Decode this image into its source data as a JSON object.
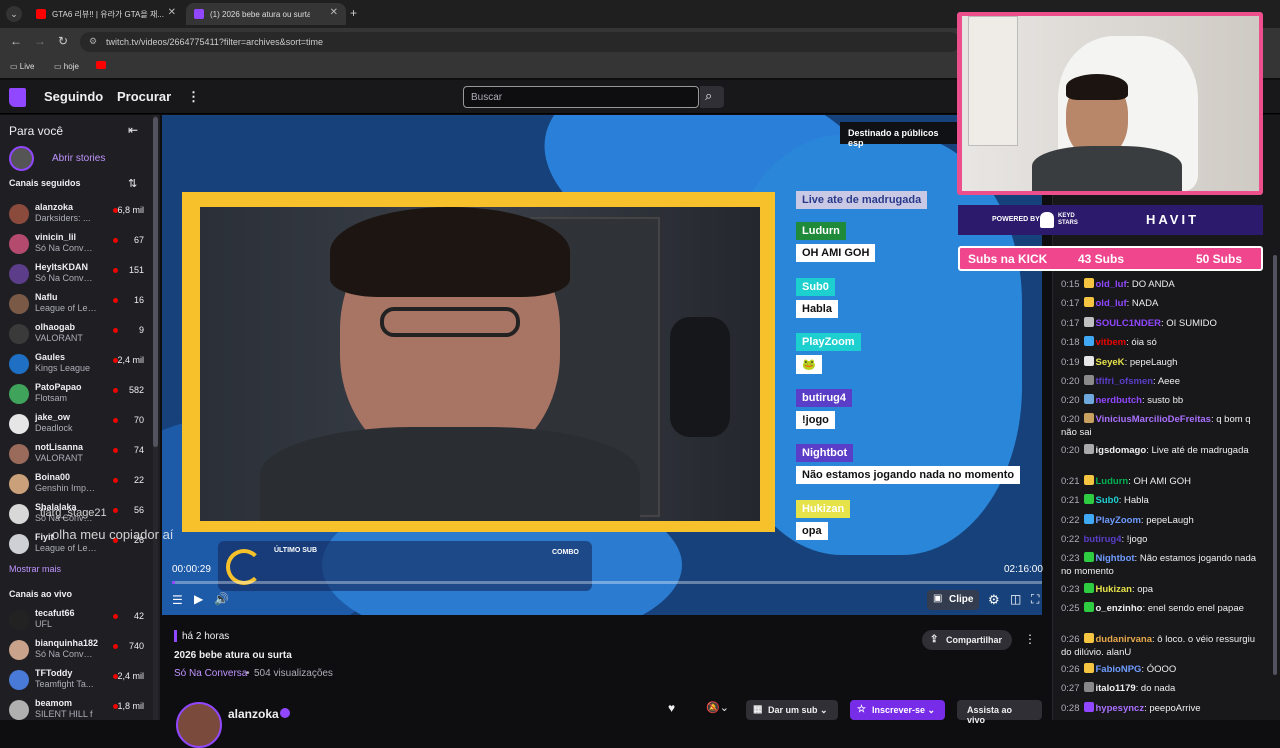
{
  "browser": {
    "tabs": [
      {
        "title": "GTA6 리뷰!! | 유라가 GTA을 재..."
      },
      {
        "title": "(1) 2026 bebe atura ou surta"
      }
    ],
    "url": "twitch.tv/videos/2664775411?filter=archives&sort=time",
    "bookmarks": [
      "Live",
      "hoje"
    ]
  },
  "topnav": {
    "following": "Seguindo",
    "browse": "Procurar",
    "search_placeholder": "Buscar"
  },
  "sidebar": {
    "for_you": "Para você",
    "open_stories": "Abrir stories",
    "followed_header": "Canais seguidos",
    "followed": [
      {
        "name": "alanzoka",
        "game": "Darksiders: ...",
        "viewers": "6,8 mil",
        "color": "#8a4b3c"
      },
      {
        "name": "vinicin_lil",
        "game": "Só Na Conversa",
        "viewers": "67",
        "color": "#b44a6e"
      },
      {
        "name": "HeyItsKDAN",
        "game": "Só Na Conversa",
        "viewers": "151",
        "color": "#5b3d8a"
      },
      {
        "name": "Naflu",
        "game": "League of Lege...",
        "viewers": "16",
        "color": "#7a5a46"
      },
      {
        "name": "olhaogab",
        "game": "VALORANT",
        "viewers": "9",
        "color": "#3a3a3a"
      },
      {
        "name": "Gaules",
        "game": "Kings League",
        "viewers": "2,4 mil",
        "color": "#1f6fc5"
      },
      {
        "name": "PatoPapao",
        "game": "Flotsam",
        "viewers": "582",
        "color": "#3fa35b"
      },
      {
        "name": "jake_ow",
        "game": "Deadlock",
        "viewers": "70",
        "color": "#e6e6e6"
      },
      {
        "name": "notLisanna",
        "game": "VALORANT",
        "viewers": "74",
        "color": "#9a6b5a"
      },
      {
        "name": "Boina00",
        "game": "Genshin Impact",
        "viewers": "22",
        "color": "#c9a07a"
      },
      {
        "name": "Shalalaka",
        "game": "Só Na Conversa",
        "viewers": "56",
        "color": "#d8d8d8"
      },
      {
        "name": "Fiyit",
        "game": "League of Lege...",
        "viewers": "26",
        "color": "#cfcfd6"
      }
    ],
    "show_more": "Mostrar mais",
    "live_header": "Canais ao vivo",
    "live": [
      {
        "name": "tecafut66",
        "game": "UFL",
        "viewers": "42",
        "color": "#222"
      },
      {
        "name": "bianquinha182",
        "game": "Só Na Conversa",
        "viewers": "740",
        "color": "#c8a28a"
      },
      {
        "name": "TFToddy",
        "game": "Teamfight Ta...",
        "viewers": "2,4 mil",
        "color": "#4a7ad8"
      },
      {
        "name": "beamom",
        "game": "SILENT HILL f",
        "viewers": "1,8 mil",
        "color": "#b0b0b0"
      }
    ]
  },
  "video": {
    "audience_tag": "Destinado a públicos esp",
    "overlay_chat": [
      {
        "user": "Live ate de madrugada",
        "userColor": "#c9c9e6",
        "msg": ""
      },
      {
        "user": "Ludurn",
        "userColor": "#1e8a3a",
        "msg": "OH AMI GOH"
      },
      {
        "user": "Sub0",
        "userColor": "#1ecfd0",
        "msg": "Habla"
      },
      {
        "user": "PlayZoom",
        "userColor": "#1ecfd0",
        "msg": "🐸"
      },
      {
        "user": "butirug4",
        "userColor": "#5a3ec8",
        "msg": "!jogo"
      },
      {
        "user": "Nightbot",
        "userColor": "#5a3ec8",
        "msg": "Não estamos jogando nada no momento"
      },
      {
        "user": "Hukizan",
        "userColor": "#e6e24a",
        "msg": "opa"
      }
    ],
    "caption_user": "tlarg_stage21",
    "caption_msg": "olha meu copiador aí",
    "last_sub": "ÚLTIMO SUB",
    "combo": "COMBO",
    "time_current": "00:00:29",
    "time_total": "02:16:00",
    "progress": 0.0036,
    "clip": "Clipe"
  },
  "info": {
    "ago": "há 2 horas",
    "title": "2026 bebe atura ou surta",
    "category": "Só Na Conversa",
    "views": "504 visualizações",
    "share": "Compartilhar",
    "channel": "alanzoka",
    "gift_sub": "Dar um sub",
    "subscribe": "Inscrever-se",
    "watch_live": "Assista ao vivo"
  },
  "webcam": {
    "powered_by": "POWERED BY",
    "sponsor1": "KEYD STARS",
    "sponsor2": "HAVIT",
    "subs_label": "Subs na KICK",
    "subs_current": "43 Subs",
    "subs_goal": "50 Subs"
  },
  "chat": [
    {
      "ts": "0:15",
      "badge": "#f5c542",
      "user": "old_luf",
      "color": "#9147ff",
      "msg": "DO ANDA"
    },
    {
      "ts": "0:17",
      "badge": "#f5c542",
      "user": "old_luf",
      "color": "#9147ff",
      "msg": "NADA"
    },
    {
      "ts": "0:17",
      "badge": "#c0c0c0",
      "user": "SOULC1NDER",
      "color": "#9147ff",
      "msg": "OI SUMIDO"
    },
    {
      "ts": "0:18",
      "badge": "#3fa9f5",
      "user": "vitbem",
      "color": "#eb0400",
      "msg": "óia só"
    },
    {
      "ts": "0:19",
      "badge": "#e6e6e6",
      "user": "SeyeK",
      "color": "#e6e24a",
      "msg": "pepeLaugh"
    },
    {
      "ts": "0:20",
      "badge": "#8a8a8a",
      "user": "tfifri_ofsmen",
      "color": "#5a3ec8",
      "msg": "Aeee"
    },
    {
      "ts": "0:20",
      "badge": "#6fa8dc",
      "user": "nerdbutch",
      "color": "#9147ff",
      "msg": "susto bb"
    },
    {
      "ts": "0:20",
      "badge": "#c8a060",
      "user": "ViniciusMarcilioDeFreitas",
      "color": "#a970ff",
      "msg": "q bom q não sai"
    },
    {
      "ts": "0:20",
      "badge": "#aaaaaa",
      "user": "igsdomago",
      "color": "#efeff1",
      "msg": "Live até de madrugada"
    },
    {
      "ts": "0:21",
      "badge": "#f5c542",
      "user": "Ludurn",
      "color": "#00b050",
      "msg": "OH AMI GOH"
    },
    {
      "ts": "0:21",
      "badge": "#2ecc40",
      "user": "Sub0",
      "color": "#1ecfd0",
      "msg": "Habla"
    },
    {
      "ts": "0:22",
      "badge": "#3fa9f5",
      "user": "PlayZoom",
      "color": "#6f9cff",
      "msg": "pepeLaugh"
    },
    {
      "ts": "0:22",
      "badge": "",
      "user": "butirug4",
      "color": "#5a3ec8",
      "msg": "!jogo"
    },
    {
      "ts": "0:23",
      "badge": "#2ecc40",
      "user": "Nightbot",
      "color": "#6f9cff",
      "msg": "Não estamos jogando nada no momento"
    },
    {
      "ts": "0:23",
      "badge": "#2ecc40",
      "user": "Hukizan",
      "color": "#e6e24a",
      "msg": "opa"
    },
    {
      "ts": "0:25",
      "badge": "#2ecc40",
      "user": "o_enzinho",
      "color": "#efeff1",
      "msg": "enel sendo enel papae"
    },
    {
      "ts": "0:26",
      "badge": "#f5c542",
      "user": "dudanirvana",
      "color": "#e6a84a",
      "msg": "ô loco. o véio ressurgiu do dilúvio. alanU"
    },
    {
      "ts": "0:26",
      "badge": "#f5c542",
      "user": "FabioNPG",
      "color": "#6f9cff",
      "msg": "ÓOOO"
    },
    {
      "ts": "0:27",
      "badge": "#888888",
      "user": "italo1179",
      "color": "#efeff1",
      "msg": "do nada"
    },
    {
      "ts": "0:28",
      "badge": "#9147ff",
      "user": "hypesyncz",
      "color": "#a970ff",
      "msg": "peepoArrive"
    }
  ]
}
